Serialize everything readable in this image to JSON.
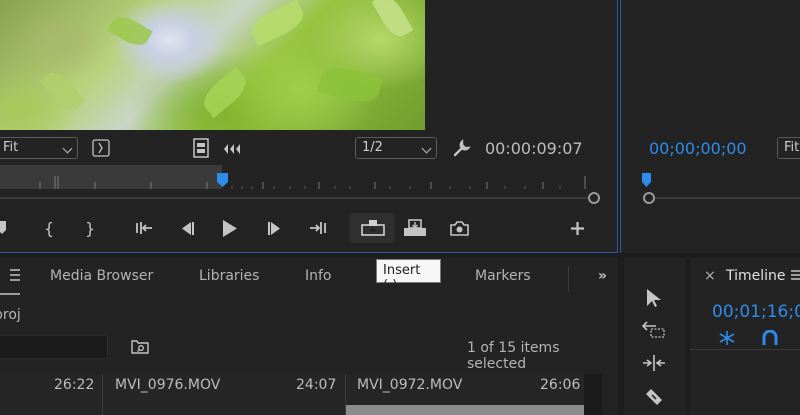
{
  "source_monitor": {
    "fit_label": "Fit",
    "resolution": "1/2",
    "timecode": "00:00:09:07",
    "playhead_fraction": 0.37
  },
  "program_monitor": {
    "timecode": "00;00;00;00",
    "fit_label": "Fit"
  },
  "tooltip": {
    "text": "Insert (,)"
  },
  "project_panel": {
    "tabs": [
      "Media Browser",
      "Libraries",
      "Info",
      "Markers"
    ],
    "project_name": "proj",
    "items_selected": "1 of 15 items selected",
    "clips": [
      {
        "duration_prev": "26:22",
        "name": "MVI_0976.MOV",
        "duration": "24:07"
      },
      {
        "name": "MVI_0972.MOV",
        "duration": "26:06"
      }
    ]
  },
  "timeline_panel": {
    "title": "Timeline",
    "timecode": "00;01;16;0"
  },
  "colors": {
    "accent": "#2d8ceb",
    "panel": "#232323",
    "border_active": "#2b5aa8"
  }
}
